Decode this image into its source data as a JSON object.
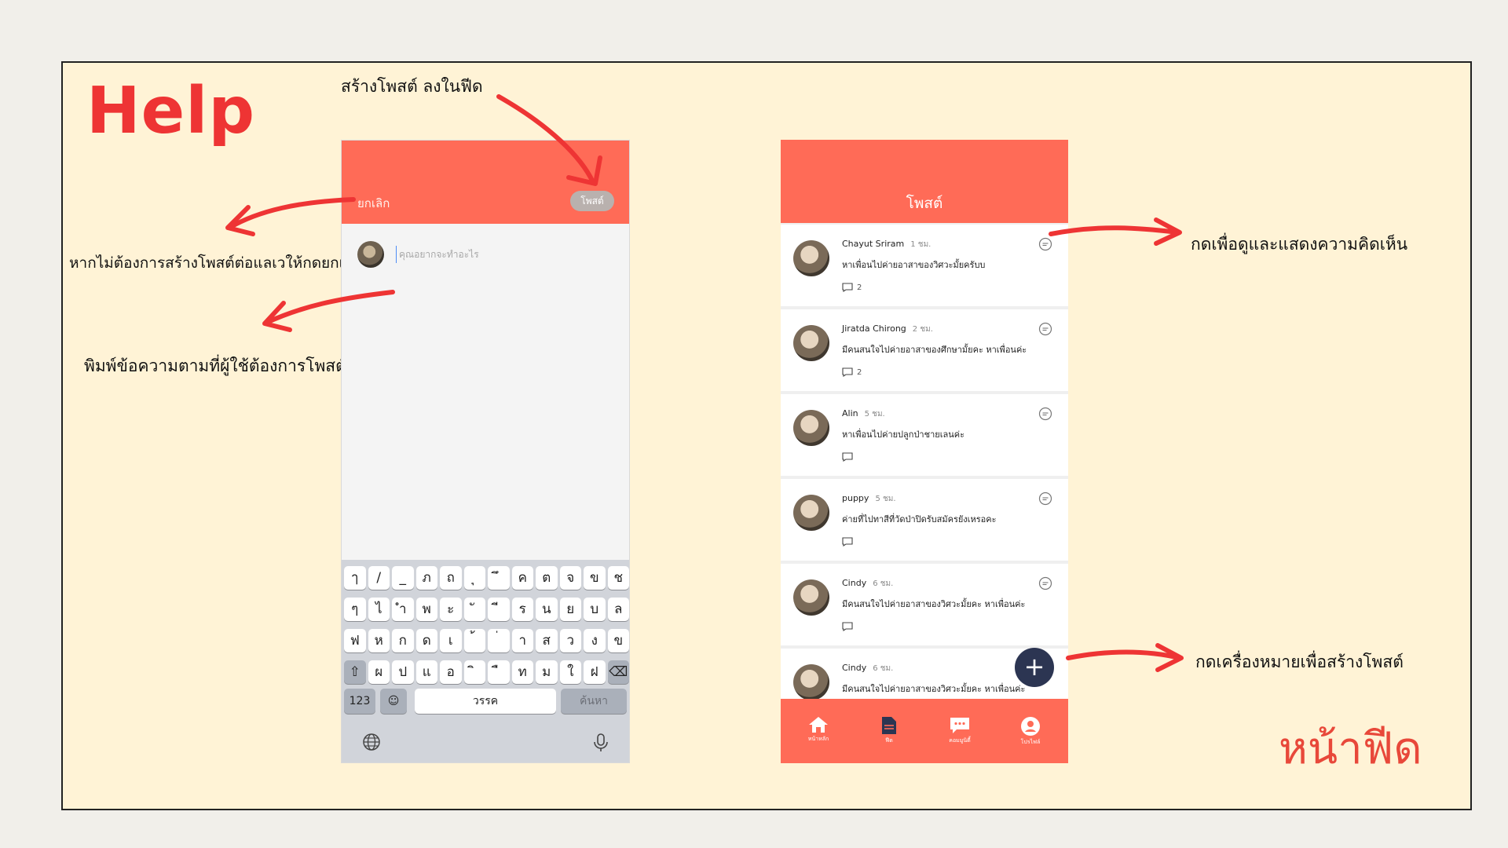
{
  "slide": {
    "title": "Help",
    "page_label": "หน้าฟีด",
    "notes": {
      "create_post": "สร้างโพสต์ ลงในฟีด",
      "cancel_hint": "หากไม่ต้องการสร้างโพสต์ต่อแลเวให้กดยกเลิก",
      "type_hint": "พิมพ์ข้อความตามที่ผู้ใช้ต้องการโพสต์",
      "comment_hint": "กดเพื่อดูและแสดงความคิดเห็น",
      "fab_hint": "กดเครื่องหมายเพื่อสร้างโพสต์"
    },
    "colors": {
      "accent": "#ff6b57",
      "arrow": "#ee3434",
      "background": "#fff3d6"
    }
  },
  "composer": {
    "cancel_label": "ยกเลิก",
    "post_button_label": "โพสต์",
    "input_placeholder": "คุณอยากจะทำอะไร",
    "keyboard": {
      "row1": [
        "ๅ",
        "/",
        "_",
        "ภ",
        "ถ",
        "ุ",
        "ึ",
        "ค",
        "ต",
        "จ",
        "ข",
        "ช"
      ],
      "row2": [
        "ๆ",
        "ไ",
        "ำ",
        "พ",
        "ะ",
        "ั",
        "ี",
        "ร",
        "น",
        "ย",
        "บ",
        "ล"
      ],
      "row3": [
        "ฟ",
        "ห",
        "ก",
        "ด",
        "เ",
        "้",
        "่",
        "า",
        "ส",
        "ว",
        "ง",
        "ข"
      ],
      "row4": [
        "ผ",
        "ป",
        "แ",
        "อ",
        "ิ",
        "ื",
        "ท",
        "ม",
        "ใ",
        "ฝ"
      ],
      "shift_icon": "shift-icon",
      "backspace_icon": "backspace-icon",
      "numbers_label": "123",
      "emoji_icon": "emoji-icon",
      "space_label": "วรรค",
      "search_label": "ค้นหา",
      "globe_icon": "globe-icon",
      "mic_icon": "mic-icon"
    }
  },
  "feed": {
    "header_title": "โพสต์",
    "posts": [
      {
        "name": "Chayut Sriram",
        "time": "1 ชม.",
        "text": "หาเพื่อนไปค่ายอาสาของวิศวะมั้ยครับบ",
        "comments": "2"
      },
      {
        "name": "Jiratda Chirong",
        "time": "2 ชม.",
        "text": "มีคนสนใจไปค่ายอาสาของศึกษามั้ยคะ หาเพื่อนค่ะ",
        "comments": "2"
      },
      {
        "name": "Alin",
        "time": "5 ชม.",
        "text": "หาเพื่อนไปค่ายปลูกป่าชายเลนค่ะ",
        "comments": ""
      },
      {
        "name": "puppy",
        "time": "5 ชม.",
        "text": "ค่ายที่ไปทาสีที่วัดป่าปิดรับสมัครยังเหรอคะ",
        "comments": ""
      },
      {
        "name": "Cindy",
        "time": "6 ชม.",
        "text": "มีคนสนใจไปค่ายอาสาของวิศวะมั้ยคะ หาเพื่อนค่ะ",
        "comments": ""
      },
      {
        "name": "Cindy",
        "time": "6 ชม.",
        "text": "มีคนสนใจไปค่ายอาสาของวิศวะมั้ยคะ หาเพื่อนค่ะ",
        "comments": ""
      }
    ],
    "fab_label": "+",
    "tabs": [
      {
        "icon": "home-icon",
        "label": "หน้าหลัก"
      },
      {
        "icon": "feed-icon",
        "label": "ฟีด"
      },
      {
        "icon": "community-icon",
        "label": "คอมมูนิตี้"
      },
      {
        "icon": "profile-icon",
        "label": "โปรไฟล์"
      }
    ]
  }
}
